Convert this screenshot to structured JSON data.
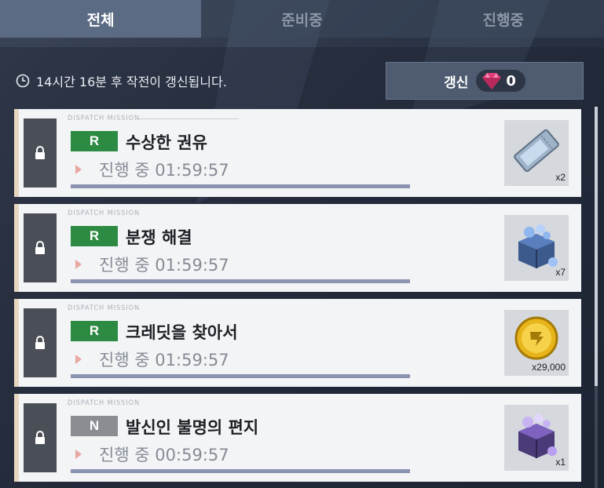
{
  "tabs": [
    {
      "label": "전체",
      "active": true
    },
    {
      "label": "준비중",
      "active": false
    },
    {
      "label": "진행중",
      "active": false
    }
  ],
  "refresh": {
    "info_text": "14시간 16분 후 작전이 갱신됩니다.",
    "button_label": "갱신",
    "gem_count": "0"
  },
  "missions": [
    {
      "tag": "DISPATCH MISSION",
      "grade": "R",
      "title": "수상한 권유",
      "status": "진행 중 01:59:57",
      "reward_icon": "ticket-icon",
      "reward_qty": "x2"
    },
    {
      "tag": "DISPATCH MISSION",
      "grade": "R",
      "title": "분쟁 해결",
      "status": "진행 중 01:59:57",
      "reward_icon": "blue-crate-icon",
      "reward_qty": "x7"
    },
    {
      "tag": "DISPATCH MISSION",
      "grade": "R",
      "title": "크레딧을 찾아서",
      "status": "진행 중 01:59:57",
      "reward_icon": "credit-coin-icon",
      "reward_qty": "x29,000"
    },
    {
      "tag": "DISPATCH MISSION",
      "grade": "N",
      "title": "발신인 불명의 편지",
      "status": "진행 중 00:59:57",
      "reward_icon": "purple-crate-icon",
      "reward_qty": "x1"
    }
  ],
  "colors": {
    "grade_r": "#2d8a43",
    "grade_n": "#8a8d92",
    "accent_gem": "#e0407a"
  }
}
